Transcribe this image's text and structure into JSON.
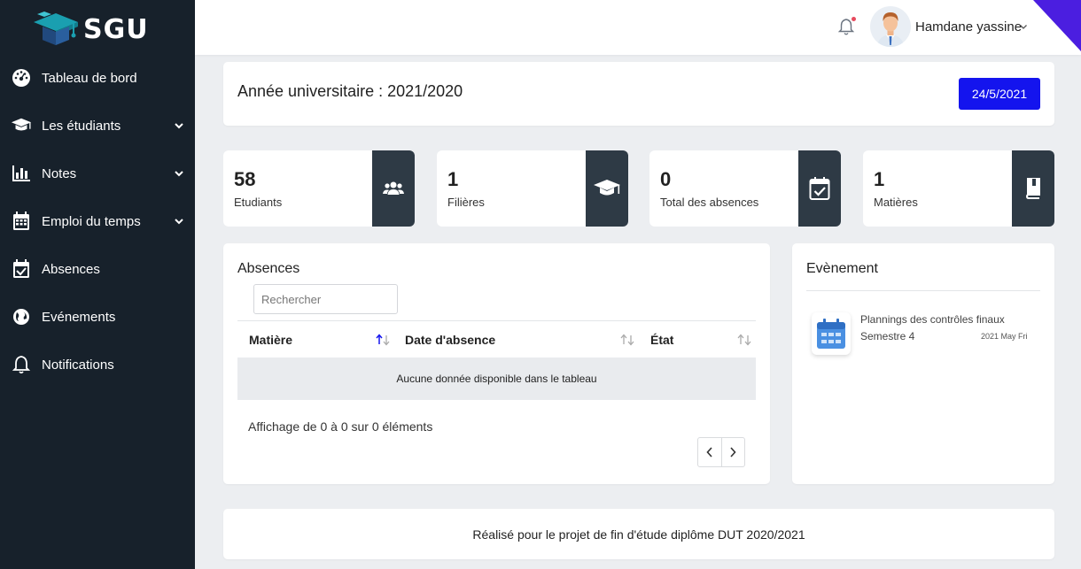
{
  "app": {
    "logo_text": "SGU"
  },
  "sidebar": {
    "items": [
      {
        "label": "Tableau de bord",
        "icon": "dashboard-icon",
        "has_submenu": false
      },
      {
        "label": "Les étudiants",
        "icon": "graduation-cap-icon",
        "has_submenu": true
      },
      {
        "label": "Notes",
        "icon": "bar-chart-icon",
        "has_submenu": true
      },
      {
        "label": "Emploi du temps",
        "icon": "calendar-icon",
        "has_submenu": true
      },
      {
        "label": "Absences",
        "icon": "calendar-check-icon",
        "has_submenu": false
      },
      {
        "label": "Evénements",
        "icon": "globe-icon",
        "has_submenu": false
      },
      {
        "label": "Notifications",
        "icon": "bell-icon",
        "has_submenu": false
      }
    ]
  },
  "header": {
    "user_name": "Hamdane yassine",
    "has_unread_notification": true
  },
  "year_card": {
    "title": "Année universitaire : 2021/2020",
    "date": "24/5/2021"
  },
  "stats": [
    {
      "value": "58",
      "label": "Etudiants",
      "icon": "users-icon"
    },
    {
      "value": "1",
      "label": "Filières",
      "icon": "graduation-cap-icon"
    },
    {
      "value": "0",
      "label": "Total des absences",
      "icon": "calendar-check-icon"
    },
    {
      "value": "1",
      "label": "Matières",
      "icon": "book-icon"
    }
  ],
  "absences": {
    "title": "Absences",
    "search_placeholder": "Rechercher",
    "columns": [
      "Matière",
      "Date d'absence",
      "État"
    ],
    "empty_message": "Aucune donnée disponible dans le tableau",
    "info": "Affichage de 0 à 0 sur 0 éléments"
  },
  "events": {
    "title": "Evènement",
    "items": [
      {
        "name": "Plannings des contrôles finaux",
        "subtitle": "Semestre 4",
        "date": "2021 May Fri"
      }
    ]
  },
  "footer": {
    "text": "Réalisé pour le projet de fin d'étude diplôme DUT 2020/2021"
  },
  "colors": {
    "sidebar_bg": "#17212b",
    "primary_button": "#1414ee",
    "stat_icon_bg": "#2e3a45",
    "accent_corner": "#4b1ee0",
    "sort_active": "#1414ee"
  }
}
